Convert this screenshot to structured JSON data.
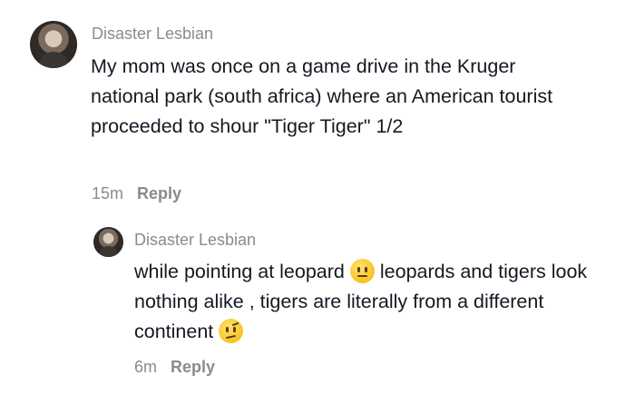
{
  "comment": {
    "username": "Disaster Lesbian",
    "text": "My mom was once on a game drive in the Kruger national park (south africa) where an American tourist proceeded to shour \"Tiger Tiger\" 1/2",
    "time": "15m",
    "reply_label": "Reply"
  },
  "reply": {
    "username": "Disaster Lesbian",
    "text_part1": "while pointing at leopard",
    "emoji1": "neutral-face-emoji",
    "text_part2": "leopards and tigers look nothing alike , tigers are literally from a different continent",
    "emoji2": "face-with-raised-eyebrow-emoji",
    "time": "6m",
    "reply_label": "Reply"
  }
}
